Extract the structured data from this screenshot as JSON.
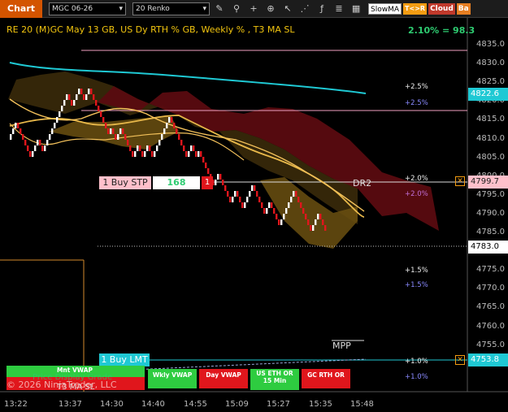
{
  "toolbar": {
    "title": "Chart",
    "instrument": "MGC 06-26",
    "bar_type": "20 Renko",
    "indicator_select": "SlowMA",
    "btn_tc": "T<>R",
    "btn_cloud": "Cloud",
    "btn_bar": "Ba"
  },
  "chart": {
    "title": "RE 20  (M)GC May 13 GB, US Dy RTH % GB, Weekly % , T3 MA SL",
    "percent_readout": "2.10% = 98.3",
    "y_ticks": [
      "4835.0",
      "4830.0",
      "4825.0",
      "4820.0",
      "4815.0",
      "4810.0",
      "4805.0",
      "4800.0",
      "4795.0",
      "4790.0",
      "4785.0",
      "4780.0",
      "4775.0",
      "4770.0",
      "4765.0",
      "4760.0",
      "4755.0",
      "4750.0"
    ],
    "x_ticks": [
      "13:22",
      "13:37",
      "14:30",
      "14:40",
      "14:55",
      "15:09",
      "15:27",
      "15:35",
      "15:48"
    ],
    "price_flags": {
      "p1": "4822.6",
      "p2": "4799.7",
      "p3": "4783.0",
      "p4": "4753.8"
    },
    "level_labels": {
      "a1": "+2.5%",
      "a2": "+2.5%",
      "b1": "+2.0%",
      "b2": "+2.0%",
      "c1": "+1.5%",
      "c2": "+1.5%",
      "d1": "+1.0%",
      "d2": "+1.0%"
    },
    "dr2": "DR2",
    "mpp": "MPP",
    "order_stp": {
      "label": "1 Buy STP",
      "qty": "168",
      "count": "1"
    },
    "order_lmt": {
      "label": "1 Buy LMT"
    },
    "watermark1": "Price Display Grade",
    "watermark2": "T3 MA SL",
    "copyright": "© 2026 NinjaTrader, LLC",
    "buttons": {
      "b1": "Mnt VWAP",
      "b2": "Wkly VWAP",
      "b3": "Day VWAP",
      "b4": "US ETH OR 15 Min",
      "b5": "GC RTH OR"
    }
  },
  "colors": {
    "accent": "#d35400",
    "up": "#ffffff",
    "down": "#e0161c",
    "cloud": "#7a0e14",
    "sma": "#1fc9d4"
  }
}
